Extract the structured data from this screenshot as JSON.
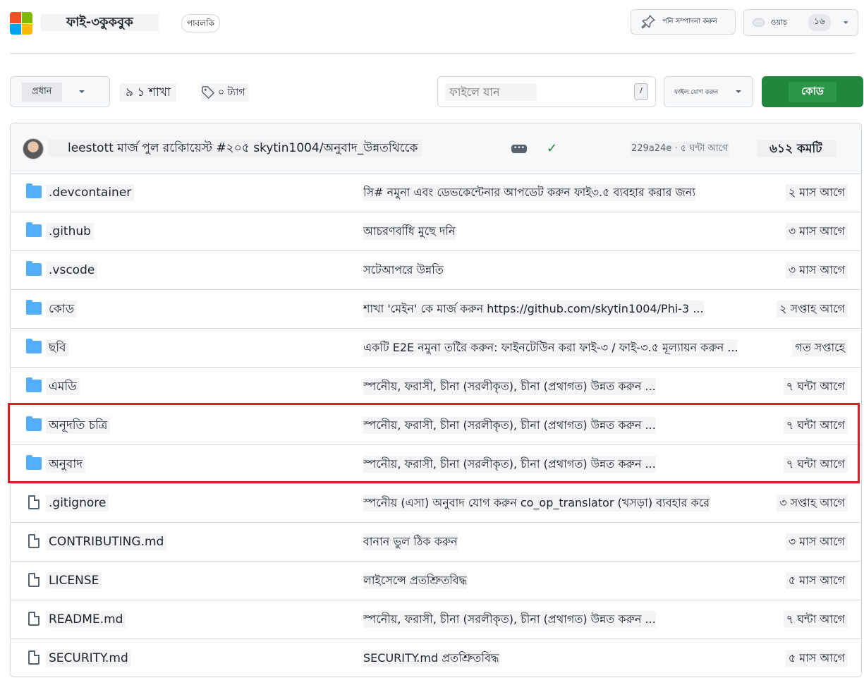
{
  "header": {
    "repo_name": "ফাই-৩কুকবুক",
    "visibility": "পাবলকি",
    "pin_label": "পনি সম্পাদনা করুন",
    "watch_label": "ওয়াচ",
    "watch_count": "১৬",
    "logo_colors": [
      "#f25022",
      "#7fba00",
      "#00a4ef",
      "#ffb900"
    ]
  },
  "toolbar": {
    "branch": "প্রধান",
    "branches_count": "৯ ১ শাখা",
    "tags_count": "০ ট্যাগ",
    "goto_file_placeholder": "ফাইলে যান",
    "goto_shortcut": "/",
    "add_file_label": "ফাইল যোগ করুন",
    "code_label": "কোড",
    "code_color": "#1f883d"
  },
  "commit": {
    "message": "leestott মার্জ পুল রকিোয়েস্ট #২০৫ skytin1004/অনুবাদ_উন্নতথিকেে",
    "meta": "229a24e · ৫ ঘন্টা আগে",
    "commits_count": "৬১২ কমটি"
  },
  "files": [
    {
      "type": "folder",
      "name": ".devcontainer",
      "message": "সি# নমুনা এবং ডেভকেন্টেনার আপডেট করুন ফাই৩.৫ ব্যবহার করার জন্য",
      "date": "২ মাস আগে"
    },
    {
      "type": "folder",
      "name": ".github",
      "message": "আচরণবধিি মুছে দনি",
      "date": "৩ মাস আগে"
    },
    {
      "type": "folder",
      "name": ".vscode",
      "message": "সটেআপরে উন্নতি",
      "date": "৩ মাস আগে"
    },
    {
      "type": "folder",
      "name": "কোড",
      "message": "শাখা 'মেইন' কে মার্জ করুন https://github.com/skytin1004/Phi-3 ...",
      "date": "২ সপ্তাহ আগে"
    },
    {
      "type": "folder",
      "name": "ছবি",
      "message": "একটি E2E নমুনা তরৈি করুন: ফাইনটেউিন করা ফাই-৩ / ফাই-৩.৫ মূল্যায়ন করুন ...",
      "date": "গত সপ্তাহে"
    },
    {
      "type": "folder",
      "name": "এমডি",
      "message": "স্পনেীয়, ফরাসী, চীনা (সরলীকৃত), চীনা (প্রথাগত) উন্নত করুন ...",
      "date": "৭ ঘন্টা আগে"
    },
    {
      "type": "folder",
      "name": "অনূদতি চত্রি",
      "message": "স্পনেীয়, ফরাসী, চীনা (সরলীকৃত), চীনা (প্রথাগত) উন্নত করুন ...",
      "date": "৭ ঘন্টা আগে"
    },
    {
      "type": "folder",
      "name": "অনুবাদ",
      "message": "স্পনেীয়, ফরাসী, চীনা (সরলীকৃত), চীনা (প্রথাগত) উন্নত করুন ...",
      "date": "৭ ঘন্টা আগে"
    },
    {
      "type": "file",
      "name": ".gitignore",
      "message": "স্পনেীয় (এসা) অনুবাদ যোগ করুন co_op_translator (খসড়া) ব্যবহার করে",
      "date": "৩ সপ্তাহ আগে"
    },
    {
      "type": "file",
      "name": "CONTRIBUTING.md",
      "message": "বানান ভুল ঠিক করুন",
      "date": "৩ মাস আগে"
    },
    {
      "type": "file",
      "name": "LICENSE",
      "message": "লাইসেন্সে প্রতশ্রিুতবিদ্ধ",
      "date": "৫ মাস আগে"
    },
    {
      "type": "file",
      "name": "README.md",
      "message": "স্পনেীয়, ফরাসী, চীনা (সরলীকৃত), চীনা (প্রথাগত) উন্নত করুন ...",
      "date": "৭ ঘন্টা আগে"
    },
    {
      "type": "file",
      "name": "SECURITY.md",
      "message": "SECURITY.md প্রতশ্রিুতবিদ্ধ",
      "date": "৫ মাস আগে"
    }
  ]
}
